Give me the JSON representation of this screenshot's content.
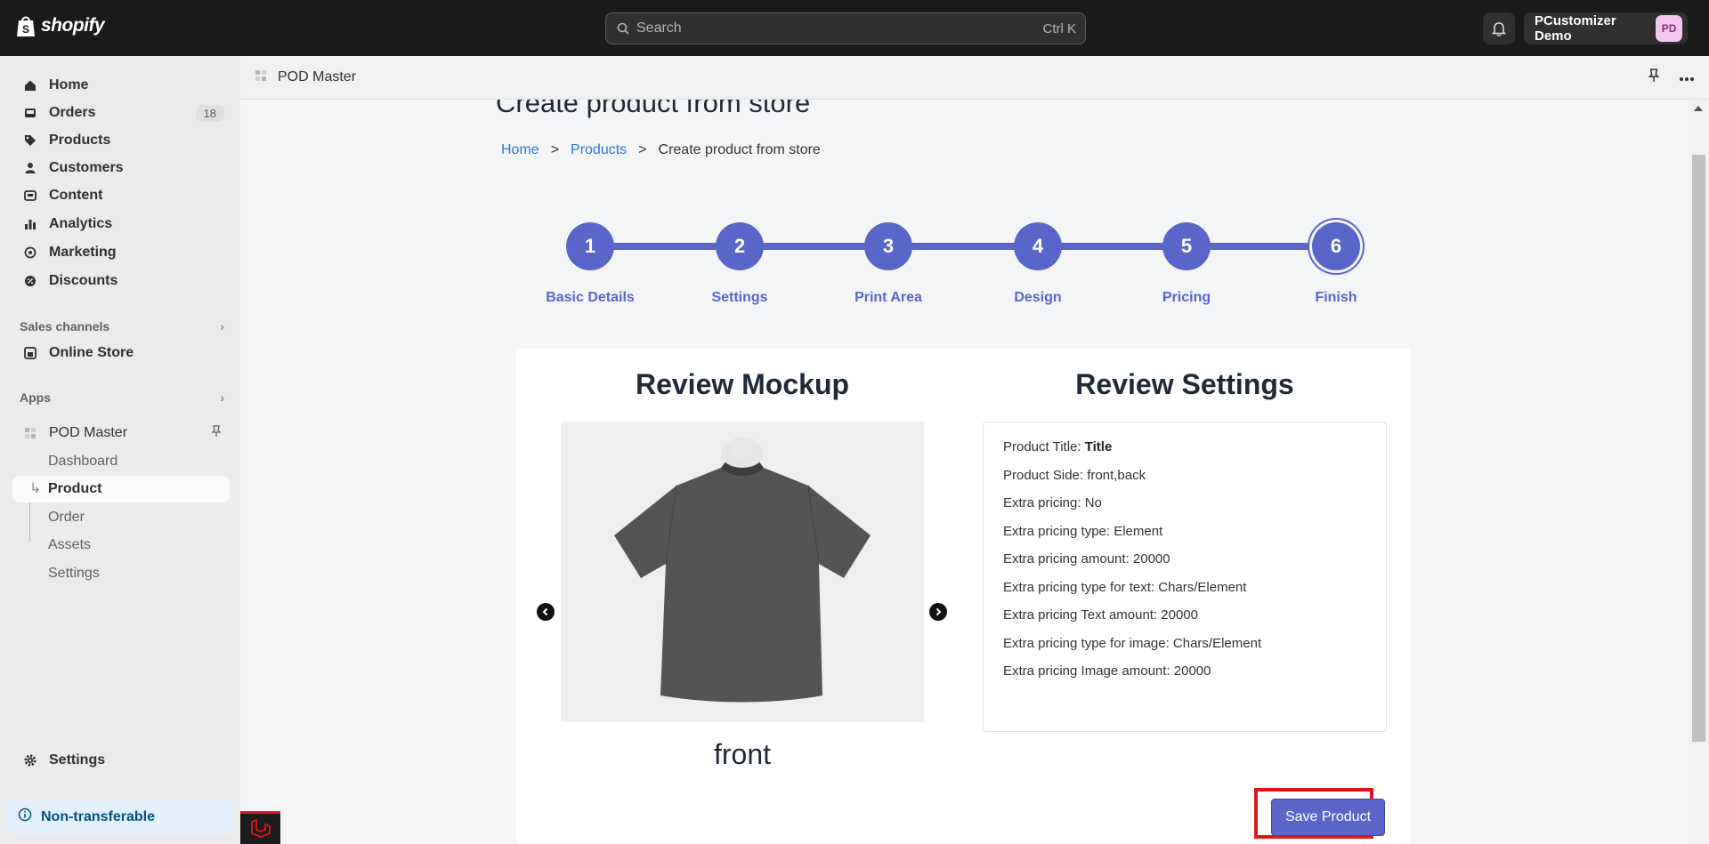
{
  "topbar": {
    "brand": "shopify",
    "search_placeholder": "Search",
    "search_shortcut": "Ctrl K",
    "account_name": "PCustomizer Demo",
    "account_initials": "PD"
  },
  "sidebar": {
    "items": [
      {
        "label": "Home",
        "icon": "home-icon"
      },
      {
        "label": "Orders",
        "icon": "inbox-icon",
        "count": "18"
      },
      {
        "label": "Products",
        "icon": "tag-icon"
      },
      {
        "label": "Customers",
        "icon": "person-icon"
      },
      {
        "label": "Content",
        "icon": "content-icon"
      },
      {
        "label": "Analytics",
        "icon": "bar-chart-icon"
      },
      {
        "label": "Marketing",
        "icon": "target-icon"
      },
      {
        "label": "Discounts",
        "icon": "discount-icon"
      }
    ],
    "sales_channels_label": "Sales channels",
    "online_store_label": "Online Store",
    "apps_label": "Apps",
    "app_name": "POD Master",
    "app_subitems": [
      "Dashboard",
      "Product",
      "Order",
      "Assets",
      "Settings"
    ],
    "settings_label": "Settings",
    "non_transferable": "Non-transferable"
  },
  "app_header": {
    "title": "POD Master"
  },
  "page": {
    "title": "Create product from store",
    "breadcrumb": [
      "Home",
      "Products",
      "Create product from store"
    ],
    "breadcrumb_separator": ">"
  },
  "stepper": {
    "steps": [
      {
        "number": "1",
        "label": "Basic Details"
      },
      {
        "number": "2",
        "label": "Settings"
      },
      {
        "number": "3",
        "label": "Print Area"
      },
      {
        "number": "4",
        "label": "Design"
      },
      {
        "number": "5",
        "label": "Pricing"
      },
      {
        "number": "6",
        "label": "Finish"
      }
    ],
    "current_step": 6
  },
  "review": {
    "mockup_heading": "Review Mockup",
    "settings_heading": "Review Settings",
    "side_label": "front",
    "settings": [
      {
        "label": "Product Title: ",
        "value": "Title"
      },
      {
        "label": "Product Side: front,back"
      },
      {
        "label": "Extra pricing: No"
      },
      {
        "label": "Extra pricing type: Element"
      },
      {
        "label": "Extra pricing amount: 20000"
      },
      {
        "label": "Extra pricing type for text: Chars/Element"
      },
      {
        "label": "Extra pricing Text amount: 20000"
      },
      {
        "label": "Extra pricing type for image: Chars/Element"
      },
      {
        "label": "Extra pricing Image amount: 20000"
      }
    ],
    "save_button": "Save Product"
  },
  "colors": {
    "accent": "#5a65c9",
    "highlight": "#e0151c",
    "topbar": "#1a1a1a"
  }
}
